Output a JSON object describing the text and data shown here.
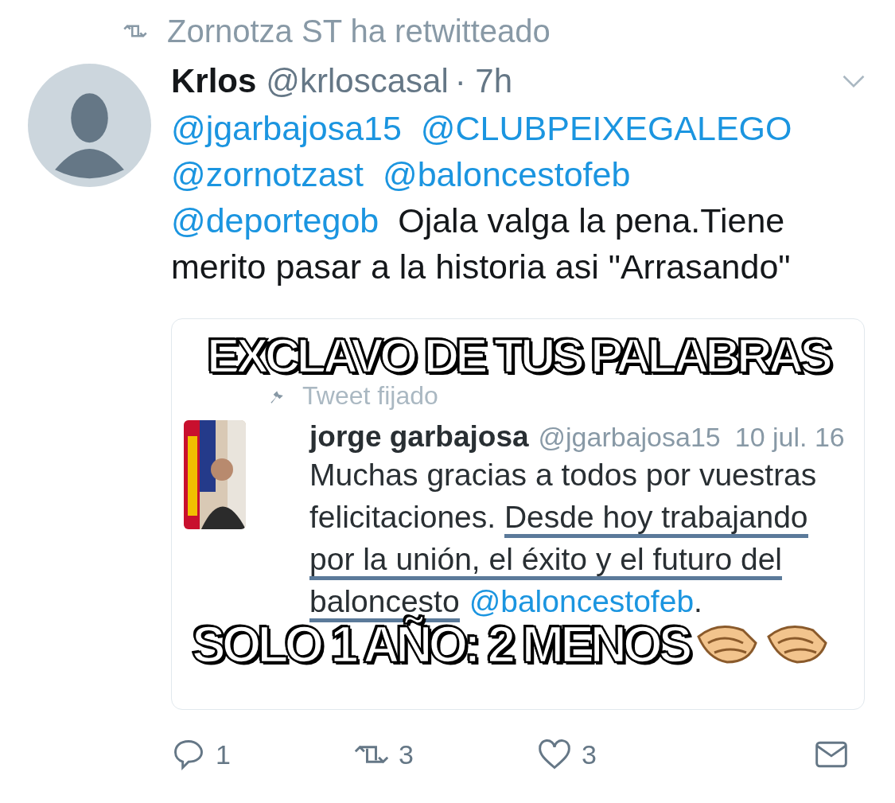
{
  "retweet_banner": {
    "text": "Zornotza ST ha retwitteado"
  },
  "tweet": {
    "name": "Krlos",
    "handle": "@krloscasal",
    "time": "· 7h",
    "body": [
      {
        "kind": "mention",
        "text": "@jgarbajosa15"
      },
      {
        "kind": "mention",
        "text": "@CLUBPEIXEGALEGO"
      },
      {
        "kind": "mention",
        "text": "@zornotzast"
      },
      {
        "kind": "mention",
        "text": "@baloncestofeb"
      },
      {
        "kind": "mention",
        "text": "@deportegob"
      },
      {
        "kind": "plain",
        "text": "Ojala valga la pena.Tiene merito pasar a la historia asi \"Arrasando\""
      }
    ],
    "media": {
      "top_caption": "EXCLAVO DE TUS PALABRAS",
      "pinned_label": "Tweet fijado",
      "inner_name": "jorge garbajosa",
      "inner_handle": "@jgarbajosa15",
      "inner_date": "10 jul. 16",
      "inner_body": [
        {
          "kind": "plain",
          "text": "Muchas gracias a todos por vuestras felicitaciones. "
        },
        {
          "kind": "marked",
          "text": "Desde hoy trabajando por la unión, el éxito y el futuro del baloncesto"
        },
        {
          "kind": "mention",
          "text": "@baloncestofeb"
        },
        {
          "kind": "plain",
          "text": "."
        }
      ],
      "bottom_caption": "SOLO 1 AÑO: 2 MENOS"
    },
    "actions": {
      "replies": "1",
      "retweets": "3",
      "likes": "3"
    }
  }
}
